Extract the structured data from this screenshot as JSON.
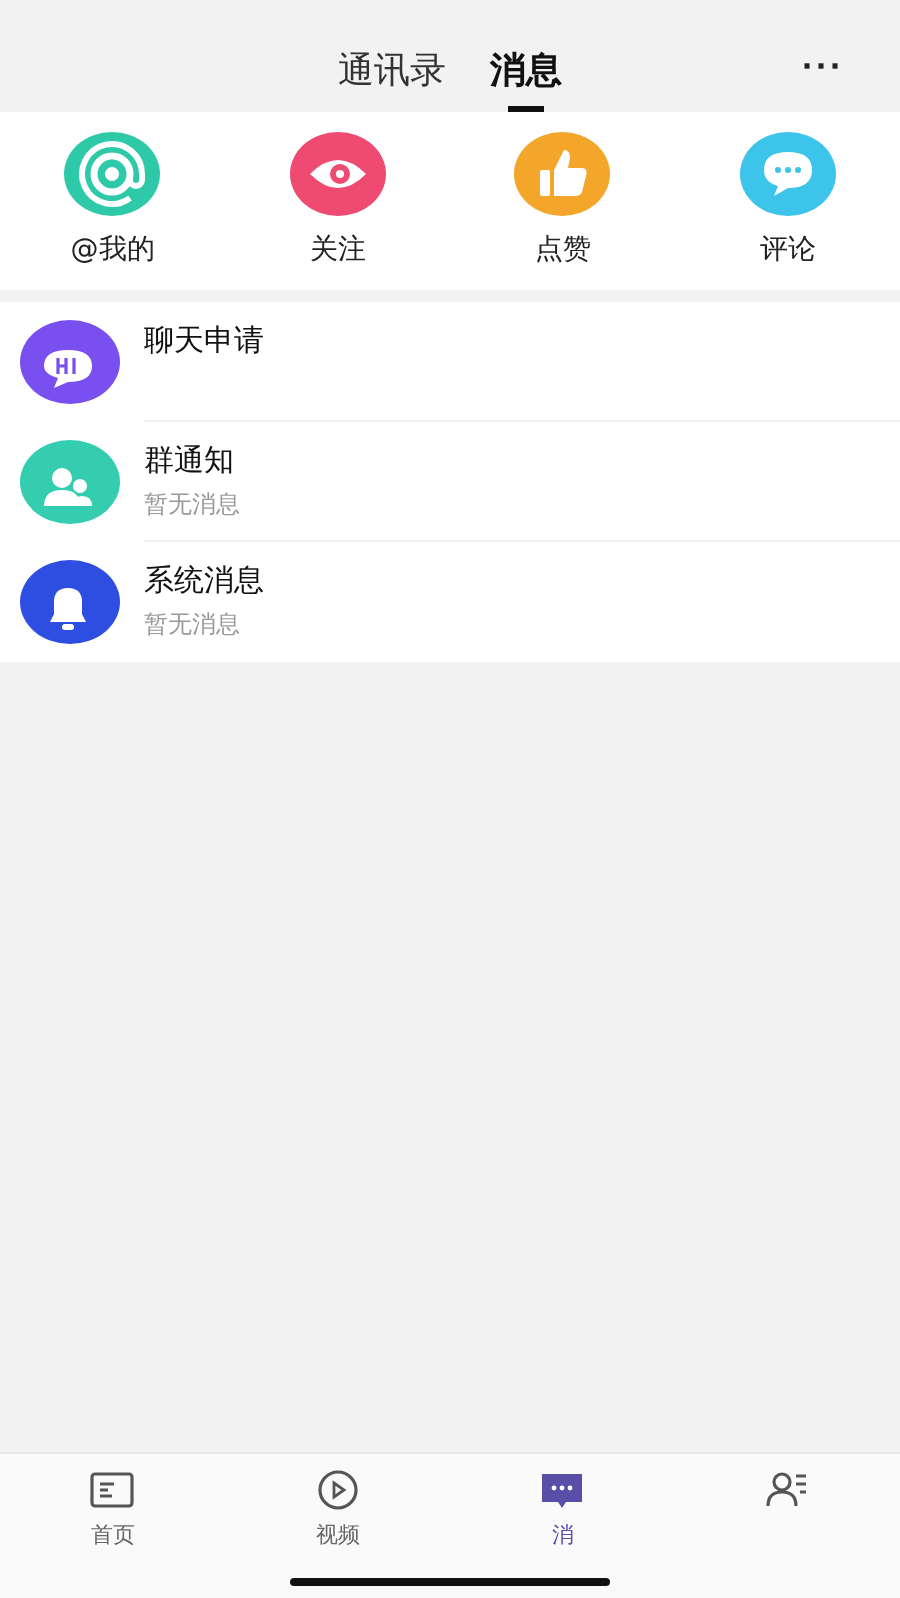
{
  "header": {
    "tabs": [
      {
        "label": "通讯录",
        "selected": false
      },
      {
        "label": "消息",
        "selected": true
      }
    ],
    "more": "···"
  },
  "shortcuts": [
    {
      "label": "@我的"
    },
    {
      "label": "关注"
    },
    {
      "label": "点赞"
    },
    {
      "label": "评论"
    }
  ],
  "messages": [
    {
      "title": "聊天申请"
    },
    {
      "title": "群通知",
      "subtitle": "暂无消息"
    },
    {
      "title": "系统消息",
      "subtitle": "暂无消息"
    }
  ],
  "tabbar": [
    {
      "label": "首页",
      "selected": false
    },
    {
      "label": "视频",
      "selected": false
    },
    {
      "label": "消",
      "selected": true
    },
    {
      "selected": false
    }
  ]
}
